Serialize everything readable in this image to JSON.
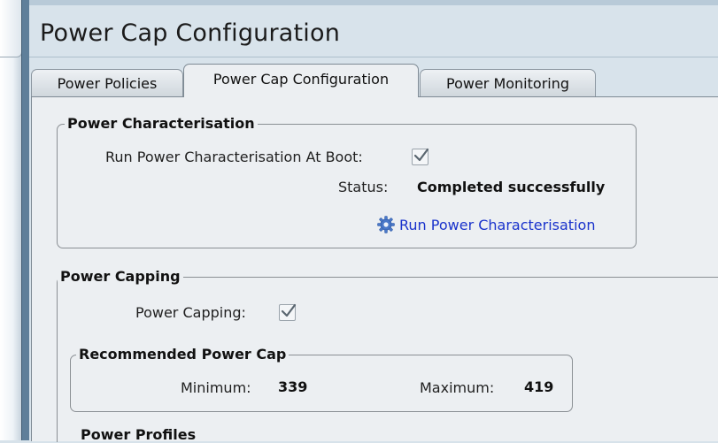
{
  "page_title": "Power Cap Configuration",
  "tabs": [
    {
      "label": "Power Policies",
      "active": false
    },
    {
      "label": "Power Cap Configuration",
      "active": true
    },
    {
      "label": "Power Monitoring",
      "active": false
    }
  ],
  "characterisation": {
    "legend": "Power Characterisation",
    "run_at_boot_label": "Run Power Characterisation At Boot:",
    "run_at_boot_checked": true,
    "status_label": "Status:",
    "status_value": "Completed successfully",
    "run_link_label": "Run Power Characterisation",
    "run_link_icon": "gear-icon"
  },
  "capping": {
    "legend": "Power Capping",
    "power_capping_label": "Power Capping:",
    "power_capping_checked": true,
    "recommended": {
      "legend": "Recommended Power Cap",
      "minimum_label": "Minimum:",
      "minimum_value": "339",
      "maximum_label": "Maximum:",
      "maximum_value": "419"
    }
  },
  "profiles": {
    "legend": "Power Profiles"
  },
  "colors": {
    "link": "#1a33cc",
    "splitter": "#5f7f9a",
    "panel_bg": "#eceff2",
    "header_bg": "#d8e3eb"
  }
}
